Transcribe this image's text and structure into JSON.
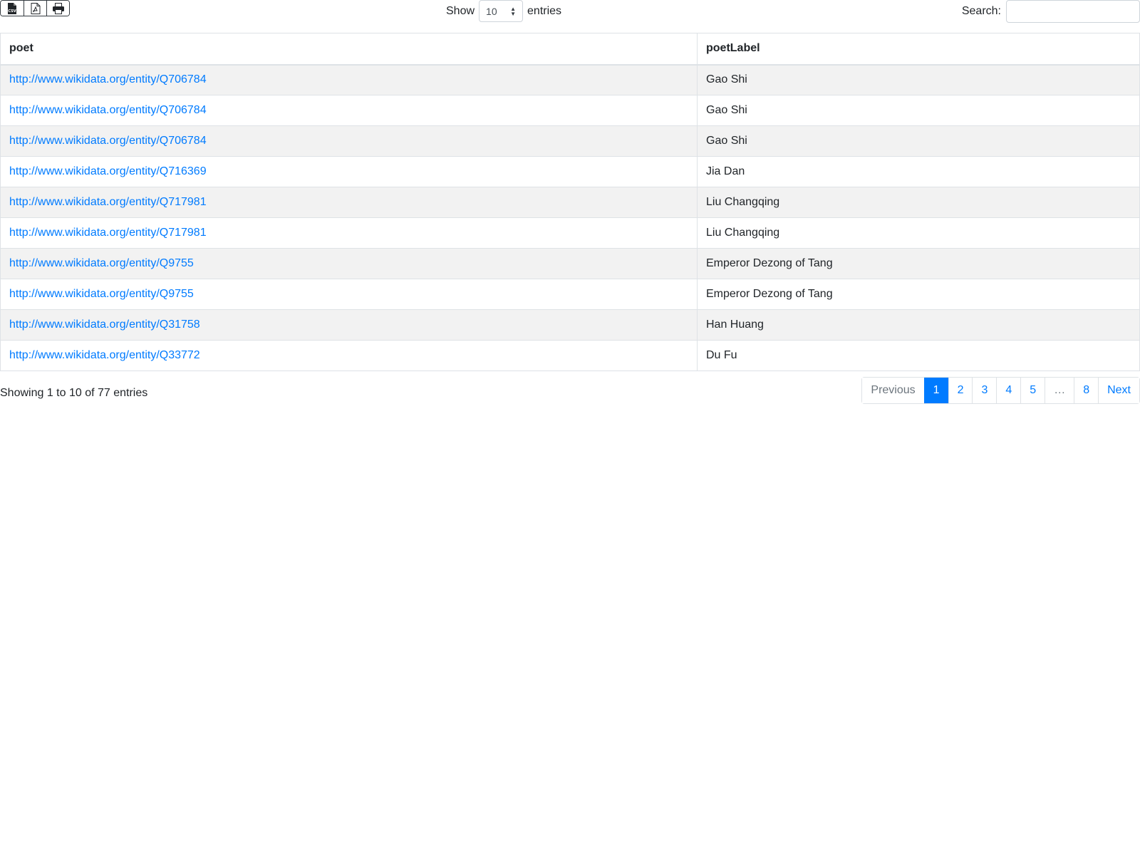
{
  "export_buttons": [
    {
      "icon": "csv-file-icon"
    },
    {
      "icon": "pdf-file-icon"
    },
    {
      "icon": "print-icon"
    }
  ],
  "length": {
    "show_label": "Show",
    "value": "10",
    "entries_label": "entries"
  },
  "search": {
    "label": "Search:",
    "value": ""
  },
  "table": {
    "headers": [
      "poet",
      "poetLabel"
    ],
    "rows": [
      {
        "poet": "http://www.wikidata.org/entity/Q706784",
        "label": "Gao Shi"
      },
      {
        "poet": "http://www.wikidata.org/entity/Q706784",
        "label": "Gao Shi"
      },
      {
        "poet": "http://www.wikidata.org/entity/Q706784",
        "label": "Gao Shi"
      },
      {
        "poet": "http://www.wikidata.org/entity/Q716369",
        "label": "Jia Dan"
      },
      {
        "poet": "http://www.wikidata.org/entity/Q717981",
        "label": "Liu Changqing"
      },
      {
        "poet": "http://www.wikidata.org/entity/Q717981",
        "label": "Liu Changqing"
      },
      {
        "poet": "http://www.wikidata.org/entity/Q9755",
        "label": "Emperor Dezong of Tang"
      },
      {
        "poet": "http://www.wikidata.org/entity/Q9755",
        "label": "Emperor Dezong of Tang"
      },
      {
        "poet": "http://www.wikidata.org/entity/Q31758",
        "label": "Han Huang"
      },
      {
        "poet": "http://www.wikidata.org/entity/Q33772",
        "label": "Du Fu"
      }
    ]
  },
  "info": "Showing 1 to 10 of 77 entries",
  "pagination": {
    "previous": "Previous",
    "pages": [
      "1",
      "2",
      "3",
      "4",
      "5",
      "…",
      "8"
    ],
    "active": "1",
    "next": "Next"
  },
  "colors": {
    "link": "#007bff",
    "stripe": "#f2f2f2",
    "border": "#dee2e6"
  }
}
